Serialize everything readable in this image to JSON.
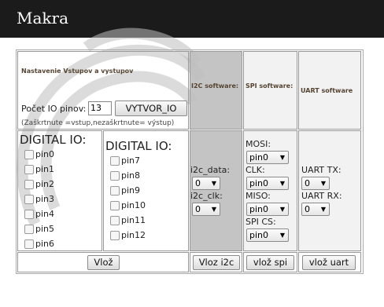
{
  "app": {
    "title": "Makra"
  },
  "config_panel": {
    "heading": "Nastavenie Vstupov a vystupov",
    "pin_count_label": "Počet IO pinov:",
    "pin_count_value": "13",
    "create_button": "VYTVOR_IO",
    "hint": "(Zaškrtnute =vstup,nezaškrtnute= výstup)"
  },
  "i2c": {
    "heading": "I2C software:",
    "data_label": "i2c_data:",
    "data_value": "0",
    "clk_label": "i2c_clk:",
    "clk_value": "0",
    "button": "Vloz i2c"
  },
  "spi": {
    "heading": "SPI software:",
    "mosi_label": "MOSI:",
    "mosi_value": "pin0",
    "clk_label": "CLK:",
    "clk_value": "pin0",
    "miso_label": "MISO:",
    "miso_value": "pin0",
    "cs_label": "SPI CS:",
    "cs_value": "pin0",
    "button": "vlož spi"
  },
  "uart": {
    "heading": "UART software",
    "tx_label": "UART TX:",
    "tx_value": "0",
    "rx_label": "UART RX:",
    "rx_value": "0",
    "button": "vlož uart"
  },
  "digital_io_left": {
    "heading": "DIGITAL IO:",
    "pins": [
      "pin0",
      "pin1",
      "pin2",
      "pin3",
      "pin4",
      "pin5",
      "pin6"
    ]
  },
  "digital_io_right": {
    "heading": "DIGITAL IO:",
    "pins": [
      "pin7",
      "pin8",
      "pin9",
      "pin10",
      "pin11",
      "pin12"
    ]
  },
  "insert_button": "Vlož",
  "icons": {
    "checkbox": "checkbox-icon",
    "dropdown": "dropdown-arrow-icon"
  }
}
